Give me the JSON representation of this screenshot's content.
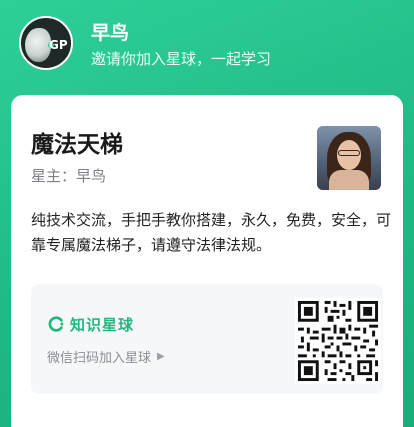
{
  "header": {
    "owner_name": "早鸟",
    "invite_text": "邀请你加入星球，一起学习",
    "avatar_label": "GP"
  },
  "card": {
    "planet_name": "魔法天梯",
    "owner_line": "星主：早鸟",
    "description": "纯技术交流，手把手教你搭建，永久，免费，安全，可靠专属魔法梯子，请遵守法律法规。",
    "brand_text": "知识星球",
    "scan_hint": "微信扫码加入星球",
    "scan_arrow": "▶"
  },
  "colors": {
    "header_bg": "#24c08c",
    "brand_green": "#20b97f",
    "card_bg": "#ffffff",
    "qr_box_bg": "#f6f7f8"
  },
  "icons": {
    "brand": "zsxq-logo-icon",
    "arrow": "play-arrow-icon",
    "qr": "qr-code-icon"
  }
}
